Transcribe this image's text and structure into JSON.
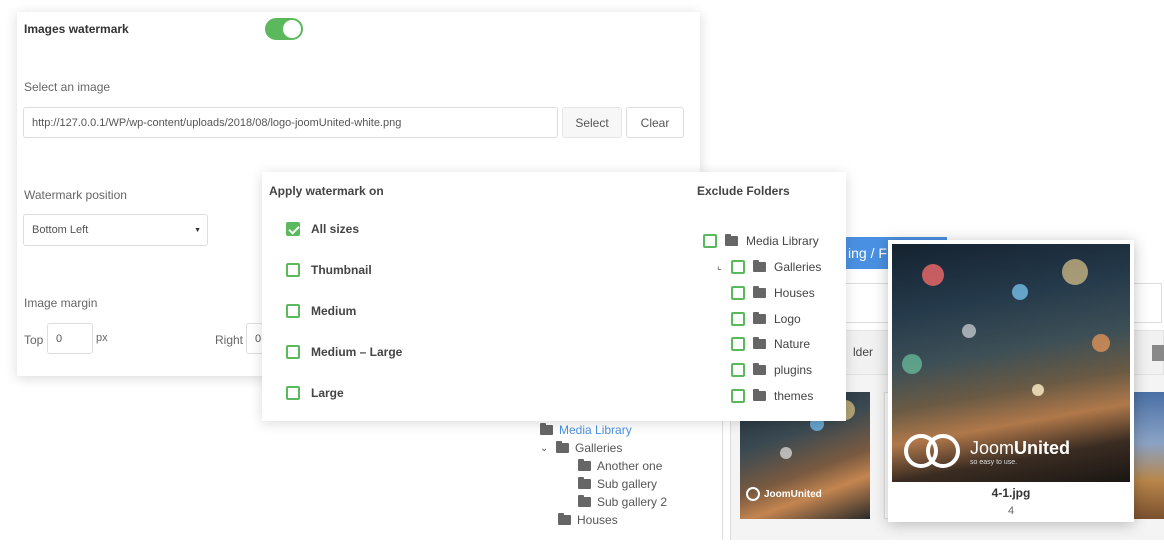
{
  "settings": {
    "watermark_label": "Images watermark",
    "watermark_enabled": true,
    "select_image_label": "Select an image",
    "image_url": "http://127.0.0.1/WP/wp-content/uploads/2018/08/logo-joomUnited-white.png",
    "select_btn": "Select",
    "clear_btn": "Clear",
    "position_label": "Watermark position",
    "position_value": "Bottom Left",
    "margin_label": "Image margin",
    "top_label": "Top",
    "top_value": "0",
    "px_unit": "px",
    "right_label": "Right",
    "right_value": "0"
  },
  "apply": {
    "title": "Apply watermark on",
    "options": [
      {
        "label": "All sizes",
        "checked": true
      },
      {
        "label": "Thumbnail",
        "checked": false
      },
      {
        "label": "Medium",
        "checked": false
      },
      {
        "label": "Medium – Large",
        "checked": false
      },
      {
        "label": "Large",
        "checked": false
      }
    ]
  },
  "exclude": {
    "title": "Exclude Folders",
    "folders": [
      "Media Library",
      "Galleries",
      "Houses",
      "Logo",
      "Nature",
      "plugins",
      "themes"
    ]
  },
  "library": {
    "breadcrumb": "ing / F",
    "folder_strip": "lder",
    "tree": [
      "Media Library",
      "Galleries",
      "Another one",
      "Sub gallery",
      "Sub gallery 2",
      "Houses"
    ],
    "thumb_logo": "JoomUnited"
  },
  "preview": {
    "brand_light": "Joom",
    "brand_bold": "United",
    "tagline": "so easy to use.",
    "filename": "4-1.jpg",
    "count": "4"
  },
  "colors": {
    "accent_green": "#5cb85c",
    "link_blue": "#4a90e2"
  }
}
